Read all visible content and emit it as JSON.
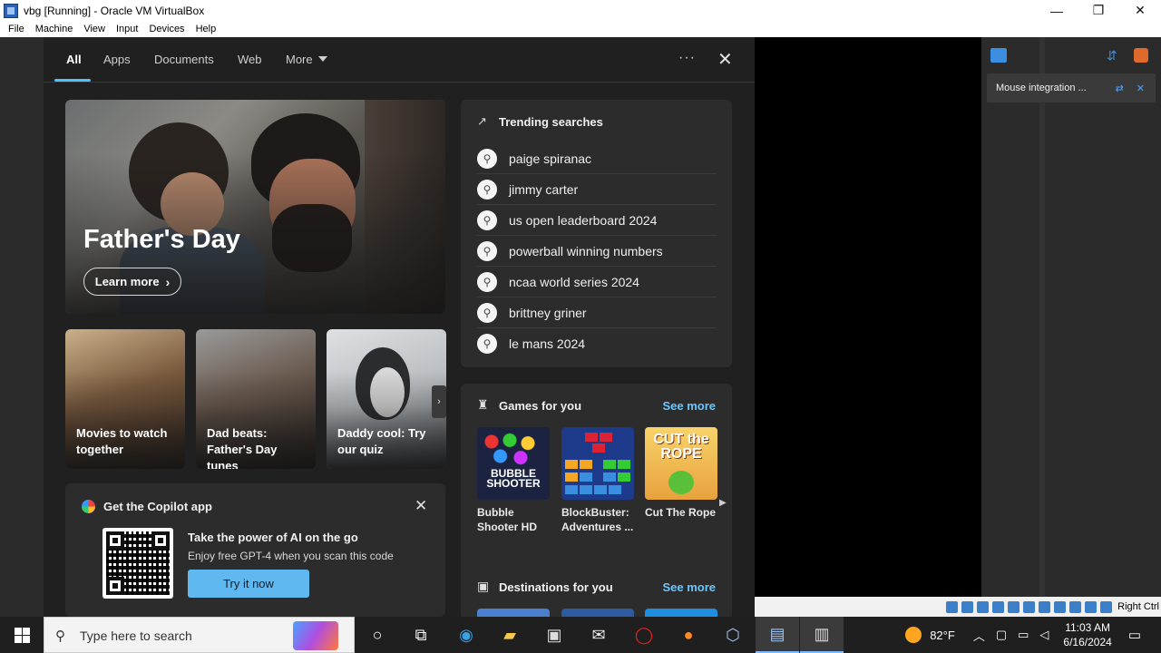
{
  "window": {
    "title": "vbg [Running] - Oracle VM VirtualBox",
    "minimize": "—",
    "restore": "❐",
    "close": "✕"
  },
  "menubar": [
    "File",
    "Machine",
    "View",
    "Input",
    "Devices",
    "Help"
  ],
  "search_panel": {
    "tabs": [
      "All",
      "Apps",
      "Documents",
      "Web",
      "More"
    ],
    "active_tab": "All",
    "more_options": "···",
    "close": "✕",
    "hero": {
      "title": "Father's Day",
      "button": "Learn more",
      "chevron": "›"
    },
    "cards": [
      {
        "caption": "Movies to watch together"
      },
      {
        "caption": "Dad beats: Father's Day tunes"
      },
      {
        "caption": "Daddy cool: Try our quiz"
      }
    ],
    "cards_next": "›",
    "copilot": {
      "heading": "Get the Copilot app",
      "close": "✕",
      "title": "Take the power of AI on the go",
      "subtitle": "Enjoy free GPT-4 when you scan this code",
      "button": "Try it now"
    },
    "trending": {
      "heading": "Trending searches",
      "icon": "↗",
      "items": [
        "paige spiranac",
        "jimmy carter",
        "us open leaderboard 2024",
        "powerball winning numbers",
        "ncaa world series 2024",
        "brittney griner",
        "le mans 2024"
      ]
    },
    "games": {
      "heading": "Games for you",
      "see_more": "See more",
      "next": "▶",
      "items": [
        {
          "name": "Bubble Shooter HD",
          "tile_text": "BUBBLE SHOOTER"
        },
        {
          "name": "BlockBuster: Adventures ..."
        },
        {
          "name": "Cut The Rope",
          "tile_text": "CUT the ROPE"
        }
      ]
    },
    "destinations": {
      "heading": "Destinations for you",
      "see_more": "See more"
    }
  },
  "vbox_notification": {
    "text": "Mouse integration ...",
    "pin": "⇄",
    "close": "✕"
  },
  "statusbar": {
    "host_key": "Right Ctrl"
  },
  "taskbar": {
    "search_placeholder": "Type here to search",
    "temperature": "82°F",
    "time": "11:03 AM",
    "date": "6/16/2024"
  },
  "colors": {
    "accent": "#4cc2ff",
    "link": "#6ac6ff",
    "copilot_button": "#60b8f0",
    "panel_bg": "#202020",
    "card_bg": "#2c2c2c"
  }
}
